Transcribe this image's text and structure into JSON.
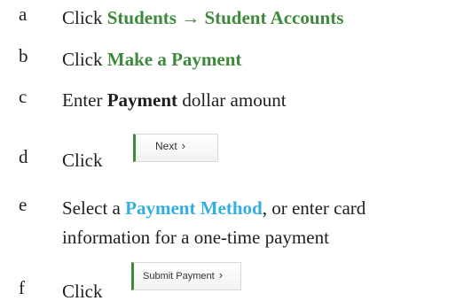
{
  "steps": [
    {
      "letter": "a",
      "parts": {
        "pre": "Click ",
        "students": "Students",
        "arrow": "→",
        "accounts": "Student Accounts"
      }
    },
    {
      "letter": "b",
      "parts": {
        "pre": "Click ",
        "link": "Make a Payment"
      }
    },
    {
      "letter": "c",
      "parts": {
        "pre": "Enter ",
        "bold": "Payment",
        "post": " dollar amount"
      }
    },
    {
      "letter": "d",
      "parts": {
        "pre": "Click",
        "button": "Next",
        "chevron": "›"
      }
    },
    {
      "letter": "e",
      "parts": {
        "pre": "Select a ",
        "link": "Payment Method",
        "post": ", or enter card",
        "line2": "information for a one-time payment"
      }
    },
    {
      "letter": "f",
      "parts": {
        "pre": "Click",
        "button": "Submit Payment",
        "chevron": "›"
      }
    }
  ],
  "colors": {
    "green_accent": "#3e8a3c",
    "blue_link": "#33aee0",
    "text": "#1f1f1f"
  },
  "icons": {
    "arrow": "right-arrow-icon",
    "chevron": "chevron-right-icon"
  }
}
